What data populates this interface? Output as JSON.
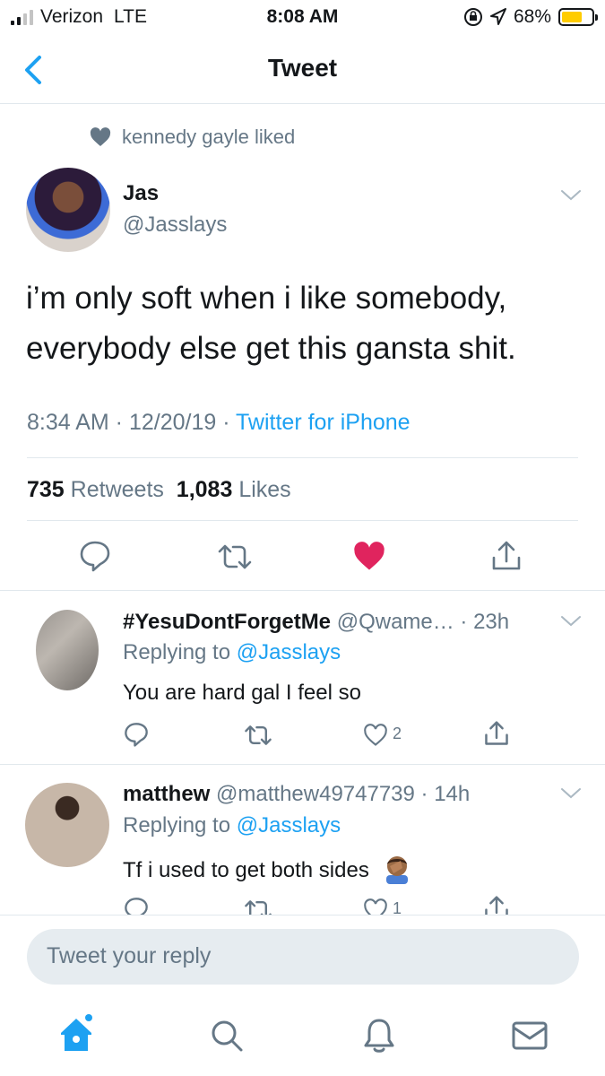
{
  "status_bar": {
    "carrier": "Verizon",
    "network": "LTE",
    "time": "8:08 AM",
    "battery_percent": "68%",
    "battery_level": 0.68
  },
  "nav": {
    "title": "Tweet"
  },
  "social_context": "kennedy gayle liked",
  "tweet": {
    "author_name": "Jas",
    "author_handle": "@Jasslays",
    "text_line1": "i’m only soft when i like somebody,",
    "text_line2": "everybody else get this gansta shit.",
    "timestamp": "8:34 AM · 12/20/19 · ",
    "source": "Twitter for iPhone",
    "retweets_count": "735",
    "retweets_label": "Retweets",
    "likes_count": "1,083",
    "likes_label": "Likes"
  },
  "replies": [
    {
      "name": "#YesuDontForgetMe",
      "handle": "@Qwame… · 23h",
      "replying_prefix": "Replying to ",
      "replying_to": "@Jasslays",
      "text": "You are hard gal I feel so",
      "like_count": "2"
    },
    {
      "name": "matthew",
      "handle": "@matthew49747739 · 14h",
      "replying_prefix": "Replying to ",
      "replying_to": "@Jasslays",
      "text": "Tf i used to get both sides",
      "like_count": "1"
    }
  ],
  "reply_box": {
    "placeholder": "Tweet your reply"
  },
  "colors": {
    "accent": "#1da1f2",
    "like_active": "#e0245e",
    "secondary_text": "#657786"
  }
}
